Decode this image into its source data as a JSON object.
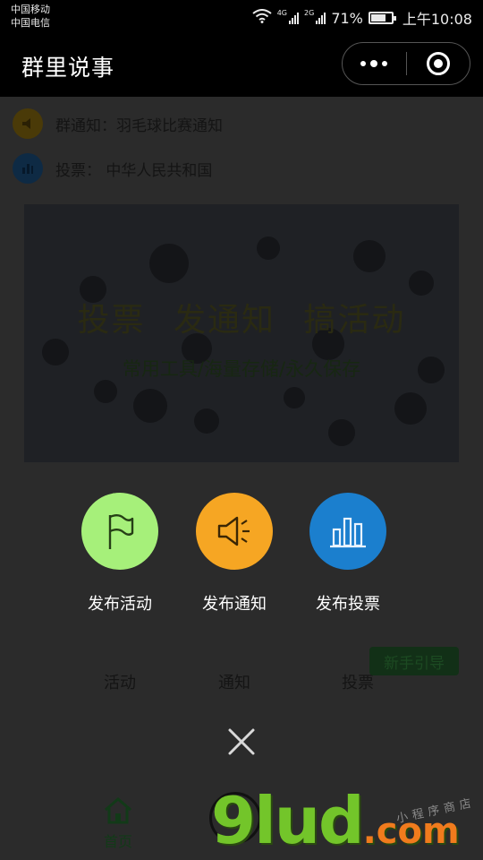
{
  "status_bar": {
    "carrier_1": "中国移动",
    "carrier_2": "中国电信",
    "net_1": "4G",
    "net_2": "2G",
    "battery": "71%",
    "time": "上午10:08"
  },
  "nav": {
    "title": "群里说事"
  },
  "page": {
    "notices": [
      {
        "label": "群通知：羽毛球比赛通知",
        "icon_color": "#4a3a08"
      },
      {
        "label": "投票：  中华人民共和国",
        "icon_color": "#0e2a44"
      }
    ],
    "banner": {
      "title": "投票 发通知 搞活动",
      "subtitle": "常用工具/海量存储/永久保存"
    },
    "ghost_labels": [
      "活动",
      "通知",
      "投票"
    ],
    "guide_button": "新手引导",
    "tabbar": {
      "home_label": "首页"
    }
  },
  "actions": [
    {
      "label": "发布活动",
      "icon": "flag-icon",
      "color": "#a6f07a"
    },
    {
      "label": "发布通知",
      "icon": "megaphone-icon",
      "color": "#f6a623"
    },
    {
      "label": "发布投票",
      "icon": "bar-chart-icon",
      "color": "#1b7fce"
    }
  ],
  "watermark": {
    "brand": "9lud",
    "suffix": ".com",
    "side_text": "小程序商店"
  }
}
